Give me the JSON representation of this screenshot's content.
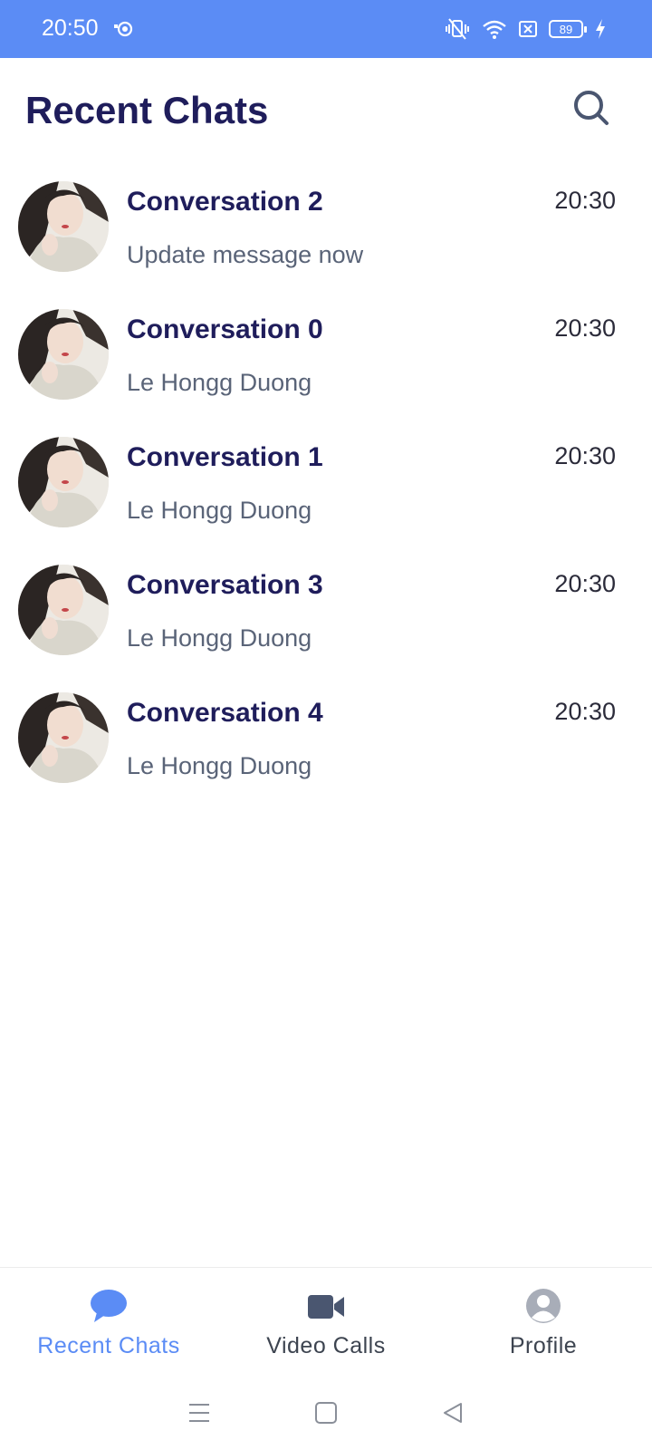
{
  "status_bar": {
    "time": "20:50",
    "battery": "89",
    "background": "#5B8CF5",
    "icons": [
      "notification-icon",
      "vibrate-icon",
      "wifi-icon",
      "sim-icon",
      "battery-icon",
      "charging-icon"
    ]
  },
  "header": {
    "title": "Recent Chats",
    "search_icon": "search-icon"
  },
  "chats": [
    {
      "name": "Conversation 2",
      "time": "20:30",
      "preview": "Update message now"
    },
    {
      "name": "Conversation 0",
      "time": "20:30",
      "preview": "Le Hongg Duong"
    },
    {
      "name": "Conversation 1",
      "time": "20:30",
      "preview": "Le Hongg Duong"
    },
    {
      "name": "Conversation 3",
      "time": "20:30",
      "preview": "Le Hongg Duong"
    },
    {
      "name": "Conversation 4",
      "time": "20:30",
      "preview": "Le Hongg Duong"
    }
  ],
  "bottom_nav": {
    "items": [
      {
        "label": "Recent Chats",
        "icon": "chat-bubble-icon",
        "active": true
      },
      {
        "label": "Video Calls",
        "icon": "video-camera-icon",
        "active": false
      },
      {
        "label": "Profile",
        "icon": "profile-icon",
        "active": false
      }
    ]
  },
  "colors": {
    "accent": "#5B8CF5",
    "title": "#1F1D5B",
    "secondary_text": "#5A6478",
    "icon_dark": "#4A5670",
    "icon_gray": "#A8ADB8"
  }
}
